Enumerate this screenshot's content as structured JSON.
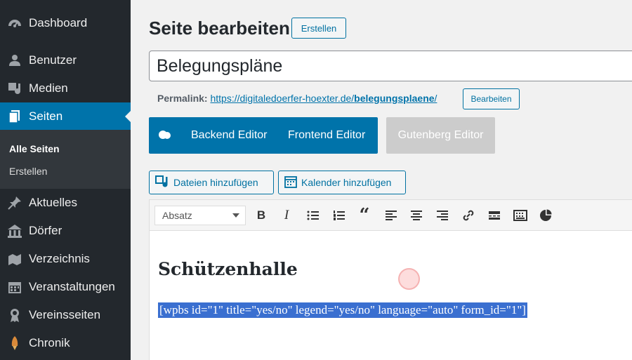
{
  "sidebar": {
    "items": [
      {
        "label": "Dashboard",
        "icon": "dashboard-icon"
      },
      {
        "label": "Benutzer",
        "icon": "user-icon"
      },
      {
        "label": "Medien",
        "icon": "media-icon"
      },
      {
        "label": "Seiten",
        "icon": "pages-icon"
      },
      {
        "label": "Aktuelles",
        "icon": "pin-icon"
      },
      {
        "label": "Dörfer",
        "icon": "building-icon"
      },
      {
        "label": "Verzeichnis",
        "icon": "map-icon"
      },
      {
        "label": "Veranstaltungen",
        "icon": "calendar-icon"
      },
      {
        "label": "Vereinsseiten",
        "icon": "award-icon"
      },
      {
        "label": "Chronik",
        "icon": "rocket-icon"
      }
    ],
    "submenu": [
      "Alle Seiten",
      "Erstellen"
    ]
  },
  "page": {
    "title": "Seite bearbeiten",
    "new_button": "Erstellen",
    "post_title": "Belegungspläne",
    "permalink_label": "Permalink:",
    "permalink_base": "https://digitaledoerfer-hoexter.de/",
    "permalink_slug": "belegungsplaene",
    "permalink_end": "/",
    "permalink_edit": "Bearbeiten"
  },
  "editors": {
    "backend": "Backend Editor",
    "frontend": "Frontend Editor",
    "gutenberg": "Gutenberg Editor"
  },
  "media": {
    "add_files": "Dateien hinzufügen",
    "add_calendar": "Kalender hinzufügen"
  },
  "toolbar": {
    "format": "Absatz"
  },
  "content": {
    "heading": "Schützenhalle",
    "shortcode": "[wpbs id=\"1\" title=\"yes/no\" legend=\"yes/no\" language=\"auto\" form_id=\"1\"]"
  },
  "colors": {
    "sidebar_bg": "#23282d",
    "accent": "#0073aa",
    "selection": "#3a6fd0"
  }
}
